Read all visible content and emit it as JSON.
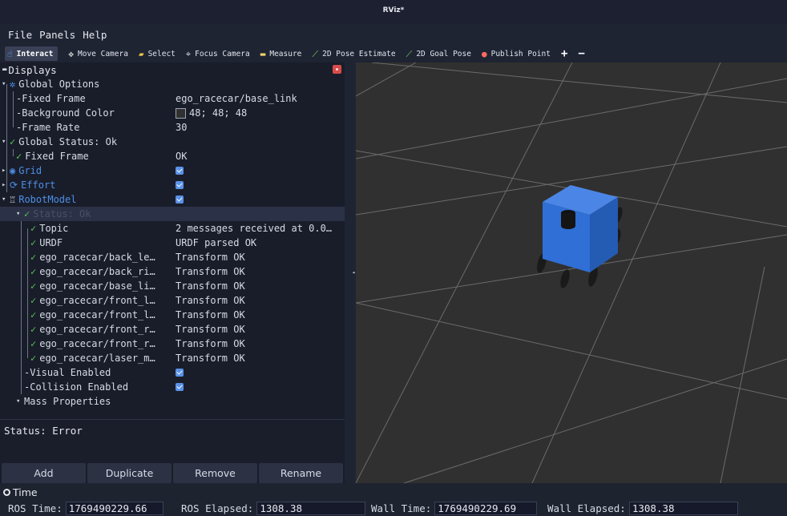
{
  "window": {
    "title": "RViz*"
  },
  "menu": [
    "File",
    "Panels",
    "Help"
  ],
  "toolbar": {
    "tools": [
      {
        "label": "Interact",
        "icon": "hand-icon",
        "active": true
      },
      {
        "label": "Move Camera",
        "icon": "move-camera-icon"
      },
      {
        "label": "Select",
        "icon": "select-icon"
      },
      {
        "label": "Focus Camera",
        "icon": "focus-camera-icon"
      },
      {
        "label": "Measure",
        "icon": "measure-icon"
      },
      {
        "label": "2D Pose Estimate",
        "icon": "pose-estimate-arrow-icon"
      },
      {
        "label": "2D Goal Pose",
        "icon": "goal-pose-arrow-icon"
      },
      {
        "label": "Publish Point",
        "icon": "map-pin-icon"
      }
    ],
    "add_symbol": "+",
    "remove_symbol": "−"
  },
  "displays": {
    "title": "Displays",
    "tree": [
      {
        "name": "Global Options",
        "value": ""
      },
      {
        "name": "Fixed Frame",
        "value": "ego_racecar/base_link"
      },
      {
        "name": "Background Color",
        "value": "48; 48; 48"
      },
      {
        "name": "Frame Rate",
        "value": "30"
      },
      {
        "name": "Global Status: Ok",
        "value": ""
      },
      {
        "name": "Fixed Frame",
        "value": "OK"
      },
      {
        "name": "Grid",
        "value": "",
        "checked": true
      },
      {
        "name": "Effort",
        "value": "",
        "checked": true
      },
      {
        "name": "RobotModel",
        "value": "",
        "checked": true
      },
      {
        "name": "Status: Ok",
        "value": ""
      },
      {
        "name": "Topic",
        "value": "2 messages received at 0.0…"
      },
      {
        "name": "URDF",
        "value": "URDF parsed OK"
      },
      {
        "name": "ego_racecar/back_le…",
        "value": "Transform OK"
      },
      {
        "name": "ego_racecar/back_ri…",
        "value": "Transform OK"
      },
      {
        "name": "ego_racecar/base_li…",
        "value": "Transform OK"
      },
      {
        "name": "ego_racecar/front_l…",
        "value": "Transform OK"
      },
      {
        "name": "ego_racecar/front_l…",
        "value": "Transform OK"
      },
      {
        "name": "ego_racecar/front_r…",
        "value": "Transform OK"
      },
      {
        "name": "ego_racecar/front_r…",
        "value": "Transform OK"
      },
      {
        "name": "ego_racecar/laser_m…",
        "value": "Transform OK"
      },
      {
        "name": "Visual Enabled",
        "value": "",
        "checked": true
      },
      {
        "name": "Collision Enabled",
        "value": "",
        "checked": true
      },
      {
        "name": "Mass Properties",
        "value": ""
      }
    ],
    "status": "Status: Error",
    "buttons": {
      "add": "Add",
      "duplicate": "Duplicate",
      "remove": "Remove",
      "rename": "Rename"
    }
  },
  "viewport": {
    "background": "#303030",
    "robot_color": "#2f6fd6"
  },
  "time": {
    "title": "Time",
    "ros_time_label": "ROS Time:",
    "ros_time": "1769490229.66",
    "ros_elapsed_label": "ROS Elapsed:",
    "ros_elapsed": "1308.38",
    "wall_time_label": "Wall Time:",
    "wall_time": "1769490229.69",
    "wall_elapsed_label": "Wall Elapsed:",
    "wall_elapsed": "1308.38"
  }
}
